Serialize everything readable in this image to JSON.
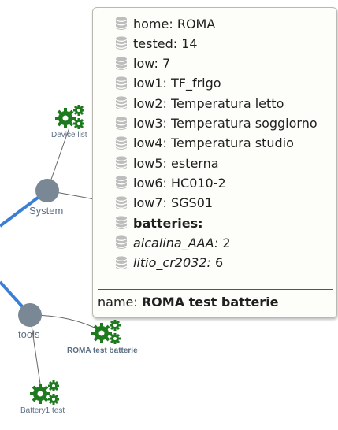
{
  "graph": {
    "nodes": {
      "device_list": "Device list",
      "system": "System",
      "tools": "tools",
      "roma_test": "ROMA test batterie",
      "battery1": "Battery1 test"
    },
    "link_color": "#3a7fd5",
    "node_color": "#7a8795",
    "gear_color": "#1e7a1e"
  },
  "tooltip": {
    "rows": [
      {
        "key": "home",
        "value": "ROMA"
      },
      {
        "key": "tested",
        "value": "14"
      },
      {
        "key": "low",
        "value": "7"
      },
      {
        "key": "low1",
        "value": "TF_frigo"
      },
      {
        "key": "low2",
        "value": "Temperatura letto"
      },
      {
        "key": "low3",
        "value": "Temperatura soggiorno"
      },
      {
        "key": "low4",
        "value": "Temperatura studio"
      },
      {
        "key": "low5",
        "value": "esterna"
      },
      {
        "key": "low6",
        "value": "HC010-2"
      },
      {
        "key": "low7",
        "value": "SGS01"
      }
    ],
    "batteries_label": "batteries:",
    "battery_rows": [
      {
        "key": "alcalina_AAA:",
        "value": "2"
      },
      {
        "key": "litio_cr2032:",
        "value": "6"
      }
    ],
    "footer": {
      "key": "name:",
      "value": "ROMA test batterie"
    }
  }
}
